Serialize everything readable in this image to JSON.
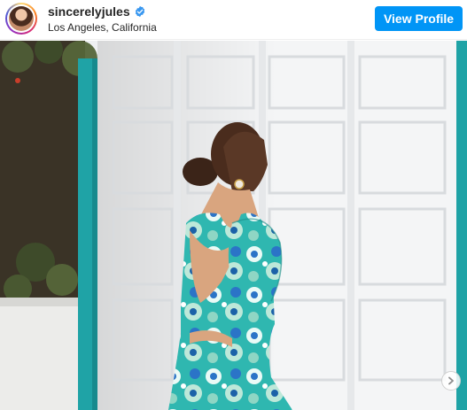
{
  "post": {
    "username": "sincerelyjules",
    "location": "Los Angeles, California",
    "verified": true,
    "view_profile_label": "View Profile"
  },
  "icons": {
    "verified": "verified-badge-icon",
    "next": "chevron-right-icon",
    "avatar": "profile-avatar"
  },
  "colors": {
    "button": "#0095f6",
    "verified": "#3897f0",
    "door": "#f4f5f6",
    "frame": "#1fa3a6",
    "dress_primary": "#2fb7b0",
    "dress_secondary": "#2b74c7"
  },
  "carousel": {
    "has_next": true
  }
}
